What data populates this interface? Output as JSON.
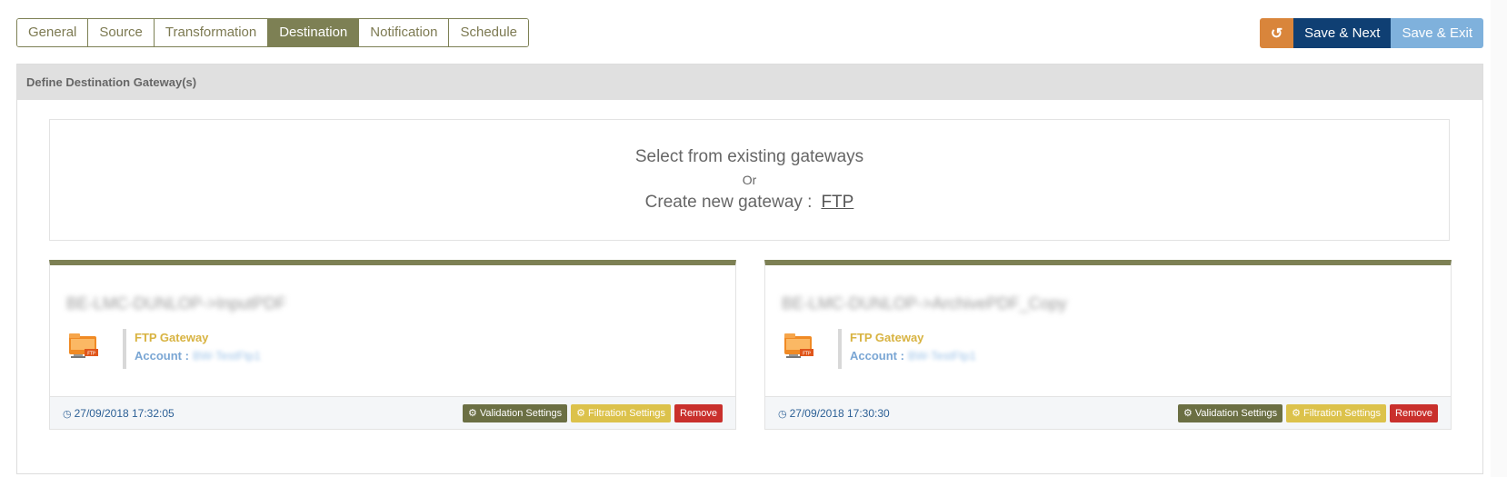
{
  "tabs": [
    {
      "label": "General"
    },
    {
      "label": "Source"
    },
    {
      "label": "Transformation"
    },
    {
      "label": "Destination",
      "active": true
    },
    {
      "label": "Notification"
    },
    {
      "label": "Schedule"
    }
  ],
  "actions": {
    "reset_icon": "reset-icon",
    "save_next": "Save & Next",
    "save_exit": "Save & Exit"
  },
  "panel": {
    "title": "Define Destination Gateway(s)"
  },
  "select": {
    "line1": "Select from existing gateways",
    "or": "Or",
    "create_label": "Create new gateway  :",
    "create_link": "FTP"
  },
  "gateways": [
    {
      "name": "BE-LMC-DUNLOP->InputPDF",
      "type": "FTP Gateway",
      "account_label": "Account :",
      "account_value": "BW-TestFtp1",
      "time": "27/09/2018 17:32:05",
      "validation": "Validation Settings",
      "filtration": "Filtration Settings",
      "remove": "Remove"
    },
    {
      "name": "BE-LMC-DUNLOP->ArchivePDF_Copy",
      "type": "FTP Gateway",
      "account_label": "Account :",
      "account_value": "BW-TestFtp1",
      "time": "27/09/2018 17:30:30",
      "validation": "Validation Settings",
      "filtration": "Filtration Settings",
      "remove": "Remove"
    }
  ],
  "colors": {
    "accent": "#7d8054",
    "primary": "#0f3f73",
    "secondary": "#7fb1dc",
    "warning": "#d9853b",
    "danger": "#c9302c",
    "yellow": "#dcc24b"
  }
}
